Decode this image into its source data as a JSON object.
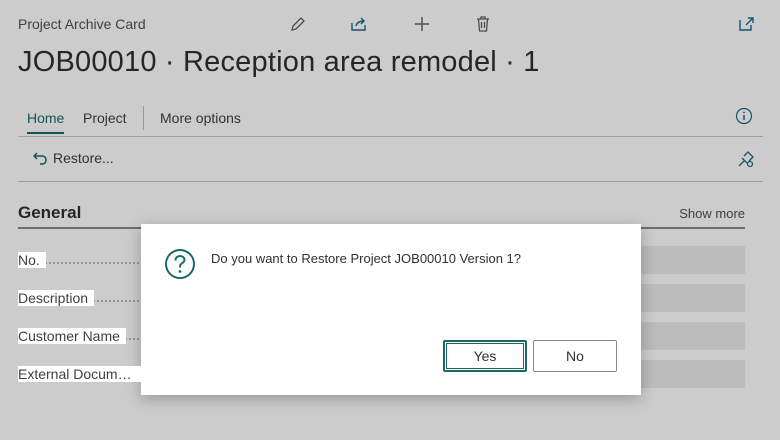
{
  "page": {
    "caption": "Project Archive Card",
    "title": "JOB00010 · Reception area remodel · 1",
    "header_icons": [
      "edit-icon",
      "share-icon",
      "add-icon",
      "delete-icon",
      "open-new-window-icon"
    ]
  },
  "action_bar": {
    "tabs": [
      {
        "label": "Home",
        "active": true
      },
      {
        "label": "Project",
        "active": false
      },
      {
        "label": "More options",
        "active": false
      }
    ]
  },
  "toolbar": {
    "restore_label": "Restore..."
  },
  "general": {
    "title": "General",
    "show_more": "Show more",
    "fields": [
      {
        "label": "No."
      },
      {
        "label": "Description"
      },
      {
        "label": "Customer Name"
      },
      {
        "label": "External Document..."
      }
    ]
  },
  "dialog": {
    "message": "Do you want to Restore Project JOB00010 Version 1?",
    "yes_label": "Yes",
    "no_label": "No",
    "accent_color": "#1a6a6a"
  }
}
